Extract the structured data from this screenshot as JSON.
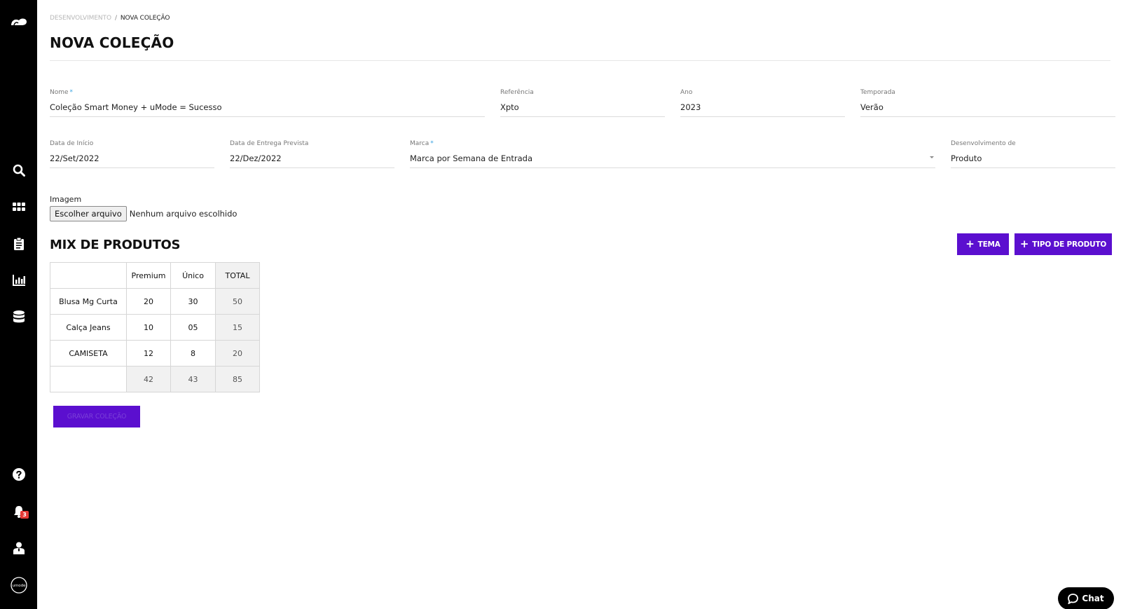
{
  "breadcrumb": {
    "parent": "DESENVOLVIMENTO",
    "separator": "/",
    "current": "NOVA COLEÇÃO"
  },
  "page_title": "NOVA COLEÇÃO",
  "form": {
    "nome": {
      "label": "Nome",
      "required_mark": "*",
      "value": "Coleção Smart Money + uMode = Sucesso"
    },
    "referencia": {
      "label": "Referência",
      "value": "Xpto"
    },
    "ano": {
      "label": "Ano",
      "value": "2023"
    },
    "temporada": {
      "label": "Temporada",
      "value": "Verão"
    },
    "data_inicio": {
      "label": "Data de Início",
      "value": "22/Set/2022"
    },
    "data_entrega": {
      "label": "Data de Entrega Prevista",
      "value": "22/Dez/2022"
    },
    "marca": {
      "label": "Marca",
      "required_mark": "*",
      "value": "Marca por Semana de Entrada"
    },
    "desenvolvimento": {
      "label": "Desenvolvimento de",
      "value": "Produto"
    },
    "imagem": {
      "label": "Imagem",
      "button": "Escolher arquivo",
      "status": "Nenhum arquivo escolhido"
    }
  },
  "mix": {
    "title": "MIX DE PRODUTOS",
    "add_tema": "TEMA",
    "add_tipo": "TIPO DE PRODUTO",
    "headers": [
      "",
      "Premium",
      "Único",
      "TOTAL"
    ],
    "rows": [
      [
        "Blusa Mg Curta",
        "20",
        "30",
        "50"
      ],
      [
        "Calça Jeans",
        "10",
        "05",
        "15"
      ],
      [
        "CAMISETA",
        "12",
        "8",
        "20"
      ]
    ],
    "totals": [
      "",
      "42",
      "43",
      "85"
    ]
  },
  "save_label": "GRAVAR COLEÇÃO",
  "notifications": {
    "count": "3"
  },
  "chat_label": "Chat",
  "colors": {
    "accent": "#5b0fcf",
    "sidebar": "#000000",
    "badge": "#e53935",
    "required": "#39a3e0"
  },
  "icons": [
    "logo-icon",
    "search-icon",
    "grid-icon",
    "clipboard-icon",
    "chart-icon",
    "database-icon",
    "help-icon",
    "bell-icon",
    "user-icon",
    "umode-icon",
    "chat-icon",
    "plus-icon",
    "caret-down-icon"
  ]
}
